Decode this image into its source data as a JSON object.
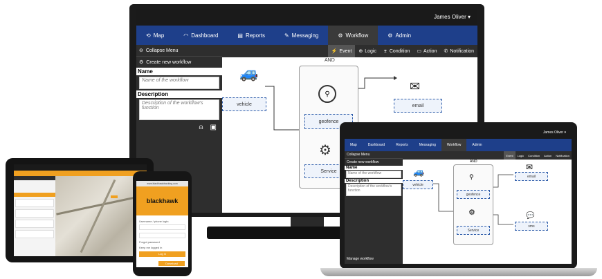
{
  "user": {
    "name": "James Oliver"
  },
  "nav": [
    {
      "icon": "map-icon",
      "label": "Map"
    },
    {
      "icon": "dashboard-icon",
      "label": "Dashboard"
    },
    {
      "icon": "reports-icon",
      "label": "Reports"
    },
    {
      "icon": "messaging-icon",
      "label": "Messaging"
    },
    {
      "icon": "workflow-icon",
      "label": "Workflow",
      "active": true
    },
    {
      "icon": "admin-icon",
      "label": "Admin"
    }
  ],
  "sidebar": {
    "collapse": "Collapse Menu",
    "create": "Create new workflow",
    "name_label": "Name",
    "name_placeholder": "Name of the workflow",
    "desc_label": "Description",
    "desc_placeholder": "Description of the workflow's function",
    "manage": "Manage workflow"
  },
  "tools": [
    {
      "icon": "event-icon",
      "label": "Event",
      "active": true
    },
    {
      "icon": "logic-icon",
      "label": "Logic"
    },
    {
      "icon": "condition-icon",
      "label": "Condition"
    },
    {
      "icon": "action-icon",
      "label": "Action"
    },
    {
      "icon": "notification-icon",
      "label": "Notification"
    }
  ],
  "workflow": {
    "group_label": "AND",
    "nodes": {
      "vehicle": "vehicle",
      "geofence": "geofence",
      "service": "Service",
      "email": "email",
      "sms": "sms"
    }
  },
  "phone": {
    "brand": "blackhawk",
    "url": "www.blackhawktracking.com",
    "username_label": "Username / phone login",
    "forgot": "Forgot password",
    "keep_label": "Keep me logged in",
    "login": "Log in",
    "download": "Download"
  }
}
